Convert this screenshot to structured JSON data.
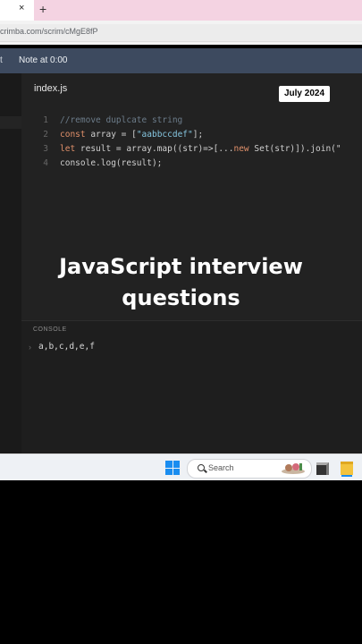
{
  "browser": {
    "tab_close": "×",
    "new_tab": "+",
    "url": "crimba.com/scrim/cMgE8fP"
  },
  "scrimba": {
    "left_text": "t",
    "note": "Note at 0:00"
  },
  "editor": {
    "filename": "index.js",
    "badge": "July 2024",
    "lines": [
      {
        "num": "1",
        "parts": [
          {
            "text": "//remove duplcate string",
            "cls": "cmt"
          }
        ]
      },
      {
        "num": "2",
        "parts": [
          {
            "text": "const",
            "cls": "kw"
          },
          {
            "text": " array = [",
            "cls": ""
          },
          {
            "text": "\"aabbccdef\"",
            "cls": "str"
          },
          {
            "text": "];",
            "cls": ""
          }
        ]
      },
      {
        "num": "3",
        "parts": [
          {
            "text": "let",
            "cls": "kw"
          },
          {
            "text": " result = array.map((str)=>[...",
            "cls": ""
          },
          {
            "text": "new",
            "cls": "kw"
          },
          {
            "text": " Set(str)]).join(\"",
            "cls": ""
          }
        ]
      },
      {
        "num": "4",
        "parts": [
          {
            "text": "console.log(result);",
            "cls": ""
          }
        ]
      }
    ]
  },
  "overlay": {
    "line1": "JavaScript interview",
    "line2": "questions"
  },
  "console": {
    "title": "CONSOLE",
    "chevron": "›",
    "output": "a,b,c,d,e,f"
  },
  "taskbar": {
    "search_label": "Search"
  },
  "colors": {
    "accent": "#1a8df0",
    "tabstrip": "#f4d3e2",
    "editor_bg": "#222222"
  }
}
